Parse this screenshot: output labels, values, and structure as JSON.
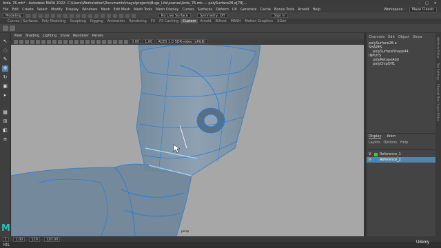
{
  "window": {
    "title": "Arda_76.mb* - Autodesk MAYA 2022: C:\\Users\\Workstation\\Documents\\maya\\projects\\Bugs_Life\\scenes\\Arda_76.mb  ---  polySurface28.e[78]...",
    "controls": [
      "–",
      "□",
      "✕"
    ]
  },
  "menu": {
    "items": [
      "File",
      "Edit",
      "Create",
      "Select",
      "Modify",
      "Display",
      "Windows",
      "Mesh",
      "Edit Mesh",
      "Mesh Tools",
      "Mesh Display",
      "Curves",
      "Surfaces",
      "Deform",
      "UV",
      "Generate",
      "Cache",
      "Bonus Tools",
      "Arnold",
      "Help"
    ],
    "workspace_label": "Workspace :",
    "workspace_value": "Maya Classic"
  },
  "statusline": {
    "mode": "Modeling",
    "live_surface": "No Live Surface",
    "symmetry": "Symmetry: Off",
    "sign_in": "Sign In"
  },
  "shelf": {
    "tabs": [
      "Curves / Surfaces",
      "Poly Modeling",
      "Sculpting",
      "Rigging",
      "Animation",
      "Rendering",
      "FX",
      "FX Caching",
      "Custom",
      "Arnold",
      "Bifrost",
      "MASH",
      "Motion Graphics",
      "XGen"
    ],
    "active_tab": "Custom"
  },
  "panel": {
    "menu": [
      "View",
      "Shading",
      "Lighting",
      "Show",
      "Renderer",
      "Panels"
    ],
    "field1": "0.00",
    "field2": "1.00",
    "colorspace": "ACES 1.0 SDR-video (sRGB)",
    "camera": "persp"
  },
  "channel_box": {
    "tabs": [
      "Channels",
      "Edit",
      "Object",
      "Show"
    ],
    "object_name": "polySurface28.e",
    "shape_label": "SHAPES",
    "shape_node": "polySurfaceShape44",
    "inputs_label": "INPUTS",
    "inputs": [
      "polyRetopoAdd",
      "polyChipOff1"
    ]
  },
  "layer_editor": {
    "tabs": [
      "Display",
      "Anim"
    ],
    "active_tab": "Display",
    "menus": [
      "Layers",
      "Options",
      "Help"
    ],
    "layers": [
      {
        "visibility": "V",
        "name": "Reference_1",
        "color": "#2fd62a",
        "selected": false
      },
      {
        "visibility": "V",
        "name": "Reference_2",
        "color": "#2a8cd6",
        "selected": true
      }
    ]
  },
  "side_edge_labels": [
    "Attribute Editor",
    "Tool Settings",
    "Channel Box / Layer Editor"
  ],
  "timebar": {
    "start": "1",
    "start2": "1.00",
    "end": "120",
    "end2": "120.00"
  },
  "helpline": {
    "mel_label": "MEL"
  },
  "watermark": "Udemy"
}
